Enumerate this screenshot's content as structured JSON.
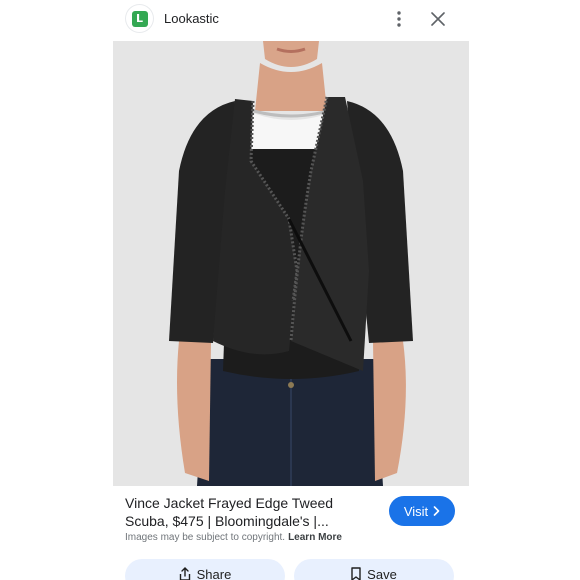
{
  "header": {
    "logo_letter": "L",
    "site_name": "Lookastic",
    "more_icon": "more-vert-icon",
    "close_icon": "close-icon"
  },
  "image": {
    "alt": "Vince Jacket Frayed Edge Tweed Scuba"
  },
  "result": {
    "title": "Vince Jacket Frayed Edge Tweed Scuba, $475 | Bloomingdale's |...",
    "visit_label": "Visit",
    "copyright_text": "Images may be subject to copyright.",
    "learn_more": "Learn More"
  },
  "actions": {
    "share_label": "Share",
    "save_label": "Save"
  },
  "colors": {
    "accent": "#1a73e8",
    "action_bg": "#e8f0fe",
    "logo_green": "#34a853"
  }
}
